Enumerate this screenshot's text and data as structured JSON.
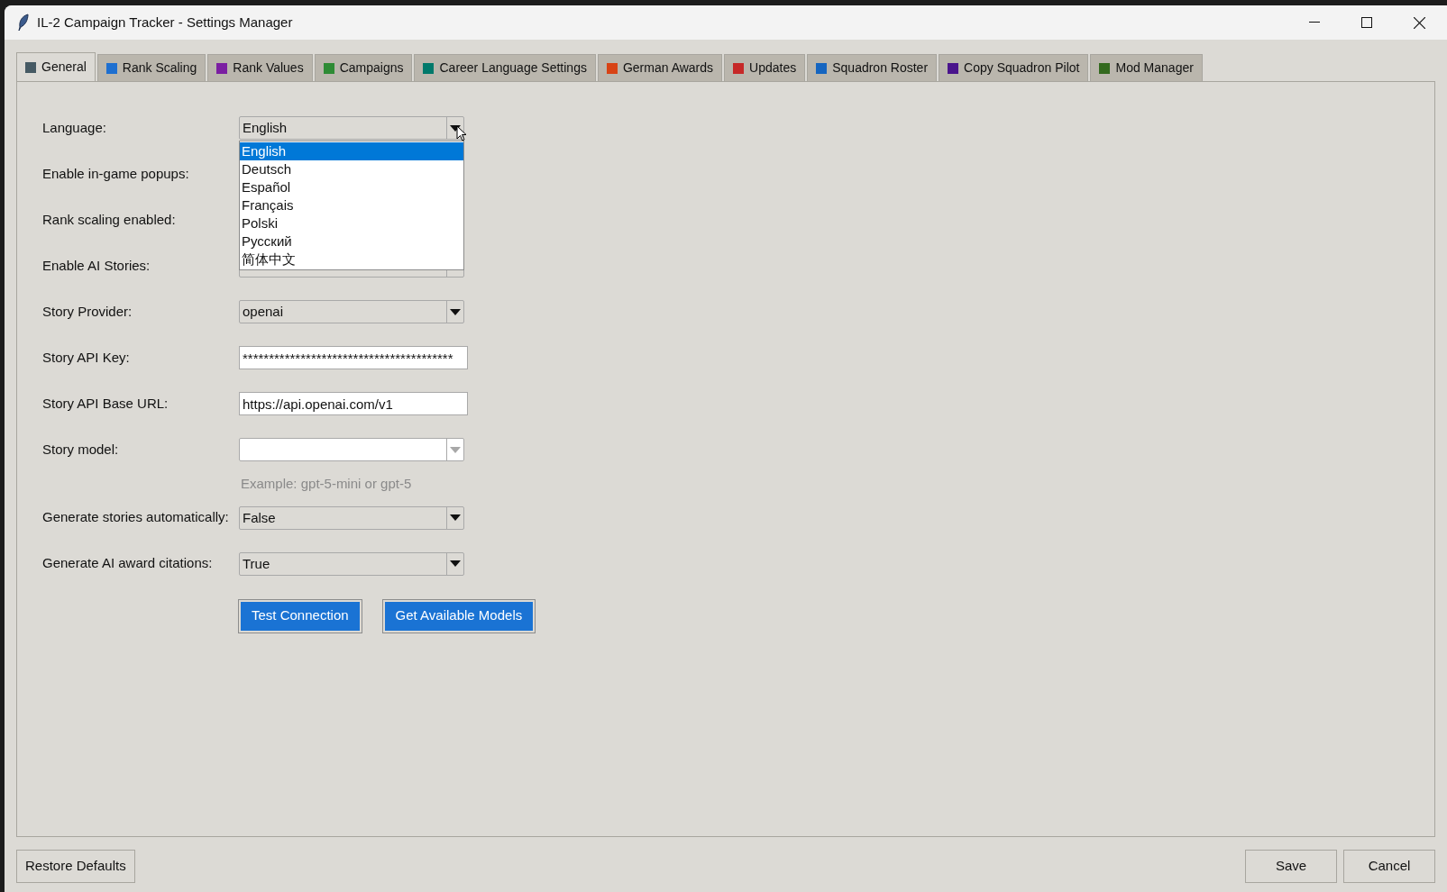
{
  "window": {
    "title": "IL-2 Campaign Tracker - Settings Manager"
  },
  "tabs": [
    {
      "label": "General",
      "color": "#465a64",
      "selected": true
    },
    {
      "label": "Rank Scaling",
      "color": "#1e6fd0",
      "selected": false
    },
    {
      "label": "Rank Values",
      "color": "#7b1fa2",
      "selected": false
    },
    {
      "label": "Campaigns",
      "color": "#2e8b35",
      "selected": false
    },
    {
      "label": "Career Language Settings",
      "color": "#00796b",
      "selected": false
    },
    {
      "label": "German Awards",
      "color": "#d84315",
      "selected": false
    },
    {
      "label": "Updates",
      "color": "#c62828",
      "selected": false
    },
    {
      "label": "Squadron Roster",
      "color": "#1565c0",
      "selected": false
    },
    {
      "label": "Copy Squadron Pilot",
      "color": "#4a148c",
      "selected": false
    },
    {
      "label": "Mod Manager",
      "color": "#33691e",
      "selected": false
    }
  ],
  "settings": [
    {
      "label": "Language:",
      "kind": "combo",
      "value": "English",
      "disabled": false
    },
    {
      "label": "Enable in-game popups:"
    },
    {
      "label": "Rank scaling enabled:"
    },
    {
      "label": "Enable AI Stories:",
      "kind": "combo"
    },
    {
      "label": "Story Provider:",
      "kind": "combo",
      "value": "openai",
      "disabled": false
    },
    {
      "label": "Story API Key:",
      "kind": "entry",
      "value": "****************************************"
    },
    {
      "label": "Story API Base URL:",
      "kind": "entry",
      "value": "https://api.openai.com/v1"
    },
    {
      "label": "Story model:",
      "kind": "combo",
      "disabled": true,
      "hint": "Example: gpt-5-mini or gpt-5"
    },
    {
      "label": "Generate stories automatically:",
      "kind": "combo",
      "value": "False",
      "disabled": false
    },
    {
      "label": "Generate AI award citations:",
      "kind": "combo",
      "value": "True",
      "disabled": false
    }
  ],
  "action_buttons": [
    "Test Connection",
    "Get Available Models"
  ],
  "language_dropdown": [
    {
      "label": "English",
      "selected": true
    },
    {
      "label": "Deutsch",
      "selected": false
    },
    {
      "label": "Español",
      "selected": false
    },
    {
      "label": "Français",
      "selected": false
    },
    {
      "label": "Polski",
      "selected": false
    },
    {
      "label": "Русский",
      "selected": false
    },
    {
      "label": "简体中文",
      "selected": false
    }
  ],
  "footer": {
    "left": "Restore Defaults",
    "right": [
      "Save",
      "Cancel"
    ]
  }
}
